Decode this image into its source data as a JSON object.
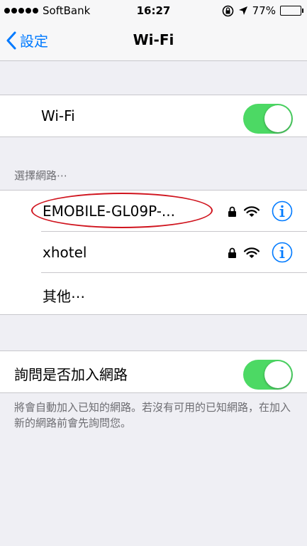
{
  "status_bar": {
    "carrier": "SoftBank",
    "time": "16:27",
    "battery_percent": "77%",
    "battery_level": 0.77,
    "icons": [
      "signal-dots-icon",
      "rotation-lock-icon",
      "location-arrow-icon",
      "battery-icon"
    ]
  },
  "nav": {
    "back_label": "設定",
    "title": "Wi-Fi"
  },
  "wifi_toggle": {
    "label": "Wi-Fi",
    "on": true
  },
  "networks": {
    "section_header": "選擇網路⋯",
    "items": [
      {
        "name": "EMOBILE-GL09P-...",
        "secured": true,
        "highlighted": true
      },
      {
        "name": "xhotel",
        "secured": true,
        "highlighted": false
      },
      {
        "name": "其他⋯"
      }
    ]
  },
  "ask_join": {
    "label": "詢問是否加入網路",
    "on": true,
    "footer": "將會自動加入已知的網路。若沒有可用的已知網路，在加入新的網路前會先詢問您。"
  },
  "colors": {
    "accent": "#007aff",
    "toggle_on": "#4cd964",
    "highlight_ellipse": "#d0141e",
    "background": "#efeff4"
  }
}
